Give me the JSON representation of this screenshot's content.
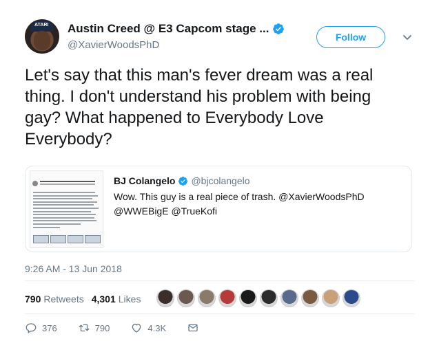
{
  "author": {
    "display_name": "Austin Creed @ E3 Capcom stage ...",
    "handle": "@XavierWoodsPhD",
    "avatar_cap_text": "ATARI",
    "verified": true
  },
  "follow_button": {
    "label": "Follow"
  },
  "tweet": {
    "text": "Let's say that this man's fever dream was a real thing. I don't understand his problem with being gay? What happened to Everybody Love Everybody?"
  },
  "quoted_tweet": {
    "display_name": "BJ Colangelo",
    "handle": "@bjcolangelo",
    "verified": true,
    "text": "Wow. This guy is a real piece of trash. @XavierWoodsPhD @WWEBigE @TrueKofi"
  },
  "timestamp": "9:26 AM - 13 Jun 2018",
  "stats": {
    "retweets_count": "790",
    "retweets_label": "Retweets",
    "likes_count": "4,301",
    "likes_label": "Likes"
  },
  "liker_avatars": [
    "#3a2e2a",
    "#6b5850",
    "#8a7a6a",
    "#b53a3a",
    "#1a1a1a",
    "#2c2c2c",
    "#5a6a8a",
    "#7a5a40",
    "#c9a07a",
    "#2a4a8a"
  ],
  "actions": {
    "reply_count": "376",
    "retweet_count": "790",
    "like_count": "4.3K"
  },
  "colors": {
    "accent": "#1da1f2",
    "text": "#14171a",
    "secondary_text": "#657786",
    "border": "#e1e8ed"
  }
}
